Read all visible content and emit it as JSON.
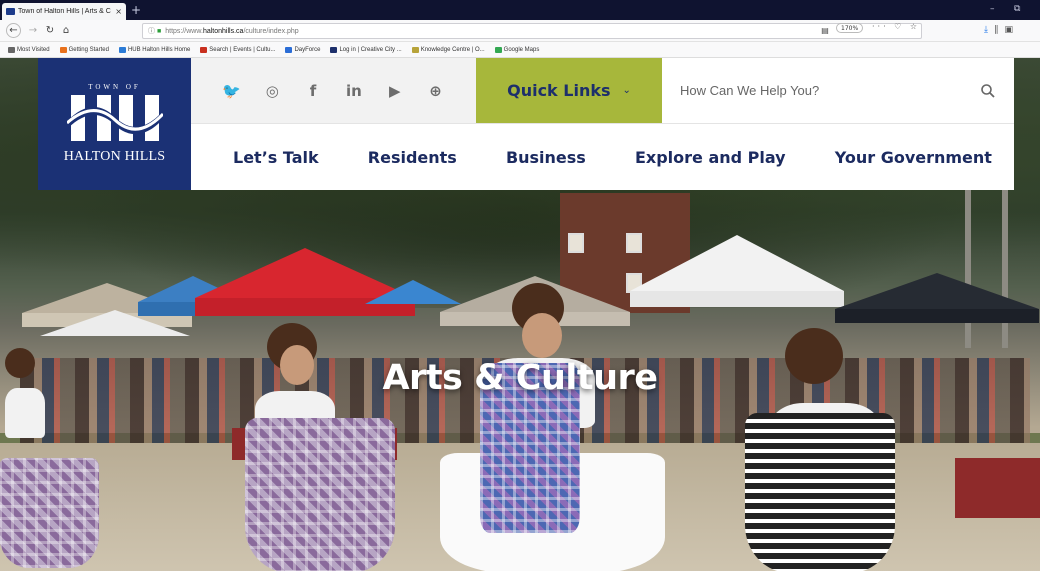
{
  "browser": {
    "tab_title": "Town of Halton Hills | Arts & C",
    "tab_close": "×",
    "new_tab": "+",
    "window_minimize": "–",
    "window_restore": "⧉",
    "url_prefix": "https://www.",
    "url_domain": "haltonhills.ca",
    "url_path": "/culture/index.php",
    "zoom": "170%",
    "bookmarks": [
      {
        "label": "Most Visited",
        "color": "#666666"
      },
      {
        "label": "Getting Started",
        "color": "#e8711c"
      },
      {
        "label": "HUB Halton Hills Home",
        "color": "#2b7bd6"
      },
      {
        "label": "Search | Events | Cultu...",
        "color": "#c9301f"
      },
      {
        "label": "DayForce",
        "color": "#2b6dd6"
      },
      {
        "label": "Log in | Creative City ...",
        "color": "#1d2f6b"
      },
      {
        "label": "Knowledge Centre | O...",
        "color": "#b7a33a"
      },
      {
        "label": "Google Maps",
        "color": "#34a853"
      }
    ]
  },
  "logo": {
    "top_text": "TOWN OF",
    "name": "HALTON HILLS"
  },
  "social_icons": [
    "twitter-icon",
    "instagram-icon",
    "facebook-icon",
    "linkedin-icon",
    "youtube-icon",
    "globe-icon"
  ],
  "social_glyphs": [
    "🐦",
    "◎",
    "f",
    "in",
    "▶",
    "⊕"
  ],
  "quick_links": {
    "label": "Quick Links",
    "chevron": "⌄"
  },
  "search": {
    "placeholder": "How Can We Help You?"
  },
  "nav": {
    "items": [
      "Let’s Talk",
      "Residents",
      "Business",
      "Explore and Play",
      "Your Government"
    ]
  },
  "hero": {
    "title": "Arts & Culture"
  },
  "colors": {
    "brand_navy": "#1b3175",
    "quick_links_green": "#a7b73b",
    "nav_text": "#1c2b60"
  }
}
